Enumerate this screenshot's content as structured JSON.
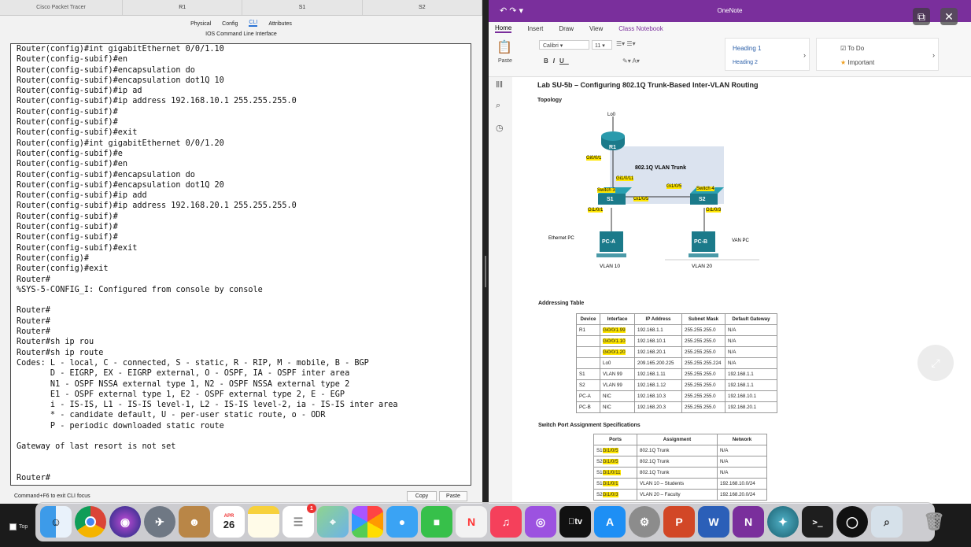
{
  "pt": {
    "tabs": [
      "Cisco Packet Tracer",
      "R1",
      "S1",
      "S2"
    ],
    "subtabs": [
      "Physical",
      "Config",
      "CLI",
      "Attributes"
    ],
    "title": "IOS Command Line Interface",
    "cli_lines": [
      "Router(config)#int gigabitEthernet 0/0/1.10",
      "Router(config-subif)#en",
      "Router(config-subif)#encapsulation do",
      "Router(config-subif)#encapsulation dot1Q 10",
      "Router(config-subif)#ip ad",
      "Router(config-subif)#ip address 192.168.10.1 255.255.255.0",
      "Router(config-subif)#",
      "Router(config-subif)#",
      "Router(config-subif)#exit",
      "Router(config)#int gigabitEthernet 0/0/1.20",
      "Router(config-subif)#e",
      "Router(config-subif)#en",
      "Router(config-subif)#encapsulation do",
      "Router(config-subif)#encapsulation dot1Q 20",
      "Router(config-subif)#ip add",
      "Router(config-subif)#ip address 192.168.20.1 255.255.255.0",
      "Router(config-subif)#",
      "Router(config-subif)#",
      "Router(config-subif)#",
      "Router(config-subif)#exit",
      "Router(config)#",
      "Router(config)#exit",
      "Router#",
      "%SYS-5-CONFIG_I: Configured from console by console",
      "",
      "Router#",
      "Router#",
      "Router#",
      "Router#sh ip rou",
      "Router#sh ip route",
      "Codes: L - local, C - connected, S - static, R - RIP, M - mobile, B - BGP",
      "       D - EIGRP, EX - EIGRP external, O - OSPF, IA - OSPF inter area",
      "       N1 - OSPF NSSA external type 1, N2 - OSPF NSSA external type 2",
      "       E1 - OSPF external type 1, E2 - OSPF external type 2, E - EGP",
      "       i - IS-IS, L1 - IS-IS level-1, L2 - IS-IS level-2, ia - IS-IS inter area",
      "       * - candidate default, U - per-user static route, o - ODR",
      "       P - periodic downloaded static route",
      "",
      "Gateway of last resort is not set",
      "",
      "",
      "Router#"
    ],
    "footer": "Command+F6 to exit CLI focus",
    "copy": "Copy",
    "paste": "Paste"
  },
  "onenote": {
    "title": "OneNote",
    "menu": [
      "Home",
      "Insert",
      "Draw",
      "View",
      "Class Notebook"
    ],
    "ribbon": {
      "paste": "Paste",
      "font": "Calibri",
      "size": "11",
      "heading1": "Heading 1",
      "heading2": "Heading 2",
      "todo": "To Do",
      "important": "Important"
    },
    "lab_title": "Lab SU-5b – Configuring 802.1Q Trunk-Based Inter-VLAN Routing",
    "topology": "Topology",
    "diagram": {
      "lo0": "Lo0",
      "r1": "R1",
      "gi001": "Gi0/0/1",
      "trunk": "802.1Q VLAN Trunk",
      "gi1011": "Gi1/0/11",
      "gi105a": "Gi1/0/5",
      "gi105b": "Gi1/0/5",
      "sw3": "Switch 3",
      "sw4": "Switch 4",
      "s1": "S1",
      "s2": "S2",
      "gi101": "Gi1/0/1",
      "gi103": "Gi1/0/3",
      "eth_pc": "Ethernet PC",
      "van_pc": "VAN PC",
      "pca": "PC-A",
      "pcb": "PC-B",
      "vlan10": "VLAN 10",
      "vlan20": "VLAN 20"
    },
    "addr_title": "Addressing Table",
    "addr_headers": [
      "Device",
      "Interface",
      "IP Address",
      "Subnet Mask",
      "Default Gateway"
    ],
    "addr_rows": [
      [
        "R1",
        "Gi0/0/1.99",
        "192.168.1.1",
        "255.255.255.0",
        "N/A"
      ],
      [
        "",
        "Gi0/0/1.10",
        "192.168.10.1",
        "255.255.255.0",
        "N/A"
      ],
      [
        "",
        "Gi0/0/1.20",
        "192.168.20.1",
        "255.255.255.0",
        "N/A"
      ],
      [
        "",
        "Lo0",
        "209.165.200.225",
        "255.255.255.224",
        "N/A"
      ],
      [
        "S1",
        "VLAN 99",
        "192.168.1.11",
        "255.255.255.0",
        "192.168.1.1"
      ],
      [
        "S2",
        "VLAN 99",
        "192.168.1.12",
        "255.255.255.0",
        "192.168.1.1"
      ],
      [
        "PC-A",
        "NIC",
        "192.168.10.3",
        "255.255.255.0",
        "192.168.10.1"
      ],
      [
        "PC-B",
        "NIC",
        "192.168.20.3",
        "255.255.255.0",
        "192.168.20.1"
      ]
    ],
    "port_title": "Switch Port Assignment Specifications",
    "port_headers": [
      "Ports",
      "Assignment",
      "Network"
    ],
    "port_rows": [
      [
        "S1",
        "Gi1/0/5",
        "802.1Q Trunk",
        "N/A"
      ],
      [
        "S2",
        "Gi1/0/5",
        "802.1Q Trunk",
        "N/A"
      ],
      [
        "S1",
        "Gi1/0/11",
        "802.1Q Trunk",
        "N/A"
      ],
      [
        "S1",
        "Gi1/0/1",
        "VLAN 10 – Students",
        "192.168.10.0/24"
      ],
      [
        "S2",
        "Gi1/0/3",
        "VLAN 20 – Faculty",
        "192.168.20.0/24"
      ]
    ]
  },
  "dock": {
    "top_label": "Top",
    "calendar_month": "APR",
    "calendar_day": "26",
    "notes_badge": "1",
    "tv_label": "tv",
    "apps": [
      "finder",
      "chrome",
      "siri",
      "launchpad",
      "contacts",
      "calendar",
      "notes",
      "reminders",
      "maps",
      "photos",
      "messages",
      "facetime",
      "news",
      "music",
      "podcasts",
      "tv",
      "app-store",
      "system-preferences",
      "powerpoint",
      "word",
      "onenote",
      "packet-tracer",
      "terminal",
      "obs",
      "preview",
      "trash"
    ]
  }
}
